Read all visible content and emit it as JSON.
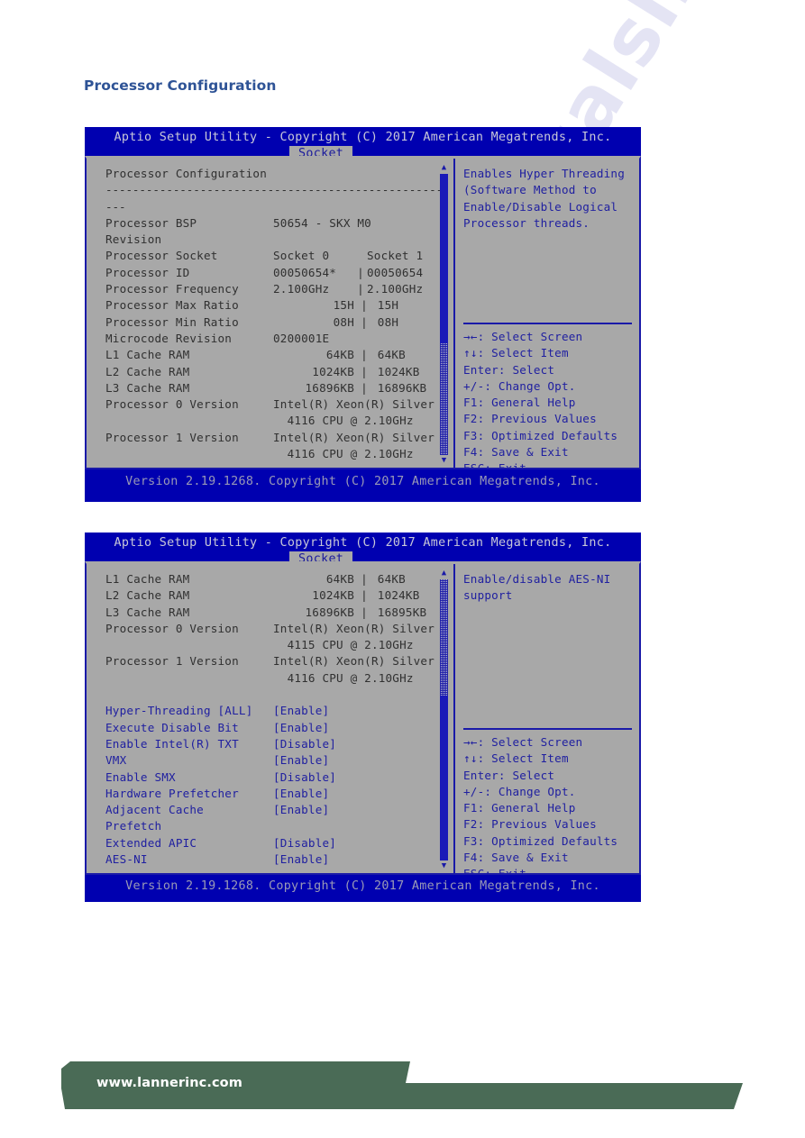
{
  "page": {
    "title": "Processor Configuration"
  },
  "bios": {
    "header_title": "Aptio Setup Utility - Copyright (C) 2017 American Megatrends, Inc.",
    "tab_label": "Socket",
    "version_footer": "Version 2.19.1268. Copyright (C) 2017 American Megatrends, Inc.",
    "scroll_up_icon": "▲",
    "scroll_down_icon": "▼"
  },
  "screen1": {
    "section_heading": "Processor Configuration",
    "section_rule": "---------------------------------------------------",
    "section_rule_tail": "---",
    "rows": [
      {
        "label": "Processor BSP",
        "value_wide": "50654 - SKX M0"
      },
      {
        "label": "Revision",
        "value_wide": ""
      },
      {
        "label": "Processor Socket",
        "v0": "Socket 0",
        "sep": " ",
        "v1": "Socket 1",
        "align": "left"
      },
      {
        "label": "Processor ID",
        "v0": "00050654*",
        "sep": "|",
        "v1": "00050654",
        "align": "left"
      },
      {
        "label": "Processor Frequency",
        "v0": "2.100GHz",
        "sep": "|",
        "v1": "2.100GHz",
        "align": "left"
      },
      {
        "label": "Processor Max Ratio",
        "v0": "15H",
        "sep": "|",
        "v1": "15H",
        "align": "right"
      },
      {
        "label": "Processor Min Ratio",
        "v0": "08H",
        "sep": "|",
        "v1": "08H",
        "align": "right"
      },
      {
        "label": "Microcode Revision",
        "v0": "0200001E",
        "sep": " ",
        "v1": "",
        "align": "left"
      },
      {
        "label": "L1 Cache RAM",
        "v0": "64KB",
        "sep": "|",
        "v1": "64KB",
        "align": "right"
      },
      {
        "label": "L2 Cache RAM",
        "v0": "1024KB",
        "sep": "|",
        "v1": "1024KB",
        "align": "right"
      },
      {
        "label": "L3 Cache RAM",
        "v0": "16896KB",
        "sep": "|",
        "v1": "16896KB",
        "align": "right"
      },
      {
        "label": "Processor 0 Version",
        "value_wide": "Intel(R) Xeon(R) Silver"
      },
      {
        "label": "",
        "value_wide": "4116 CPU @ 2.10GHz",
        "indent": true
      },
      {
        "label": "Processor 1 Version",
        "value_wide": "Intel(R) Xeon(R) Silver"
      },
      {
        "label": "",
        "value_wide": "4116 CPU @ 2.10GHz",
        "indent": true
      }
    ],
    "help": "Enables Hyper Threading\n(Software Method to\nEnable/Disable Logical\nProcessor threads."
  },
  "screen2": {
    "rows": [
      {
        "label": "L1 Cache RAM",
        "v0": "64KB",
        "sep": "|",
        "v1": "64KB",
        "align": "right"
      },
      {
        "label": "L2 Cache RAM",
        "v0": "1024KB",
        "sep": "|",
        "v1": "1024KB",
        "align": "right"
      },
      {
        "label": "L3 Cache RAM",
        "v0": "16896KB",
        "sep": "|",
        "v1": "16895KB",
        "align": "right"
      },
      {
        "label": "Processor 0 Version",
        "value_wide": "Intel(R) Xeon(R) Silver"
      },
      {
        "label": "",
        "value_wide": "4115 CPU @ 2.10GHz",
        "indent": true
      },
      {
        "label": "Processor 1 Version",
        "value_wide": "Intel(R) Xeon(R) Silver"
      },
      {
        "label": "",
        "value_wide": "4116 CPU @ 2.10GHz",
        "indent": true
      }
    ],
    "settings": [
      {
        "label": "Hyper-Threading [ALL]",
        "value": "[Enable]"
      },
      {
        "label": "Execute Disable Bit",
        "value": "[Enable]"
      },
      {
        "label": "Enable Intel(R) TXT",
        "value": "[Disable]"
      },
      {
        "label": "VMX",
        "value": "[Enable]"
      },
      {
        "label": "Enable SMX",
        "value": "[Disable]"
      },
      {
        "label": "Hardware Prefetcher",
        "value": "[Enable]"
      },
      {
        "label": "Adjacent Cache",
        "value": "[Enable]"
      },
      {
        "label": "Prefetch",
        "value": ""
      },
      {
        "label": "Extended APIC",
        "value": "[Disable]"
      },
      {
        "label": "AES-NI",
        "value": "[Enable]"
      }
    ],
    "help": "Enable/disable AES-NI\nsupport"
  },
  "keys": [
    "→←: Select Screen",
    "↑↓: Select Item",
    "Enter: Select",
    "+/-: Change Opt.",
    "F1: General Help",
    "F2: Previous Values",
    "F3: Optimized Defaults",
    "F4: Save & Exit",
    "ESC: Exit"
  ],
  "watermark": {
    "text": "manualslib.com"
  },
  "footer": {
    "url": "www.lannerinc.com",
    "banner_color": "#4a6b56"
  }
}
